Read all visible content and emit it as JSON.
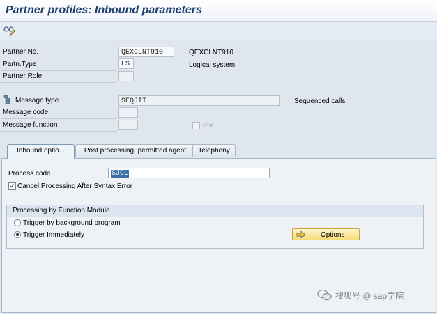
{
  "title": "Partner profiles: Inbound parameters",
  "toolbar": {
    "icon": "glasses-pencil-icon"
  },
  "header": {
    "partner_no": {
      "label": "Partner No.",
      "value": "QEXCLNT910",
      "desc": "QEXCLNT910"
    },
    "partner_type": {
      "label": "Partn.Type",
      "value": "LS",
      "desc": "Logical system"
    },
    "partner_role": {
      "label": "Partner Role",
      "value": ""
    },
    "message_type": {
      "label": "Message type",
      "value": "SEQJIT",
      "desc": "Sequenced calls"
    },
    "message_code": {
      "label": "Message code",
      "value": ""
    },
    "message_function": {
      "label": "Message function",
      "value": ""
    },
    "test": {
      "label": "Test",
      "checked": false
    }
  },
  "tabs": [
    {
      "label": "Inbound optio...",
      "active": true
    },
    {
      "label": "Post processing: permitted agent",
      "active": false
    },
    {
      "label": "Telephony",
      "active": false
    }
  ],
  "inbound": {
    "process_code": {
      "label": "Process code",
      "value": "SJCL"
    },
    "cancel_processing": {
      "label": "Cancel Processing After Syntax Error",
      "checked": true
    },
    "group": {
      "title": "Processing by Function Module",
      "options": [
        {
          "label": "Trigger by background program",
          "selected": false
        },
        {
          "label": "Trigger Immediately",
          "selected": true
        }
      ],
      "options_button": "Options"
    }
  },
  "watermark": "搜狐号 @ sap学院"
}
